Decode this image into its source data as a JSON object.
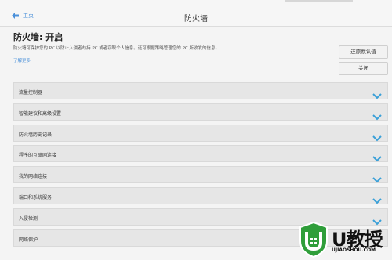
{
  "header": {
    "back_label": "主页",
    "title": "防火墙"
  },
  "status": {
    "heading": "防火墙: 开启",
    "description": "防火墙可保护您的 PC 以防止入侵者劫持 PC 或者窃取个人信息。还可根据策略管理您的 PC 所收发的信息。",
    "learn_more": "了解更多"
  },
  "buttons": {
    "restore_label": "还原默认值",
    "close_label": "关闭"
  },
  "sections": [
    {
      "label": "流量控制器"
    },
    {
      "label": "智能建议和高级设置"
    },
    {
      "label": "防火墙历史记录"
    },
    {
      "label": "程序的互联网连接"
    },
    {
      "label": "我的网络连接"
    },
    {
      "label": "端口和系统服务"
    },
    {
      "label": "入侵检测"
    },
    {
      "label": "网络保护"
    }
  ],
  "watermark": {
    "logo_text": "U教授",
    "site": "UJIAOSHOU.COM"
  },
  "colors": {
    "accent": "#4a90d9",
    "chevron": "#3aa0d8",
    "section_bg": "#e6e6e6",
    "watermark_green": "#2f9e3a"
  }
}
